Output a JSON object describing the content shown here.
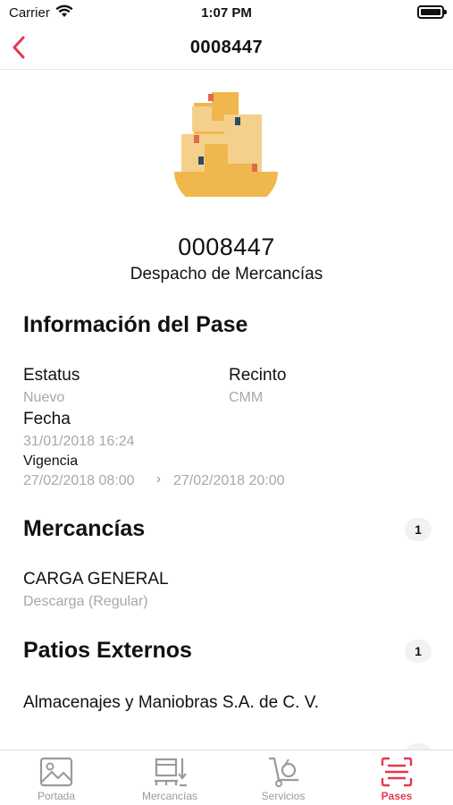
{
  "status_bar": {
    "carrier": "Carrier",
    "time": "1:07 PM"
  },
  "nav": {
    "title": "0008447"
  },
  "header": {
    "number": "0008447",
    "subtitle": "Despacho de Mercancías"
  },
  "info": {
    "title": "Información del Pase",
    "estatus_label": "Estatus",
    "estatus_value": "Nuevo",
    "recinto_label": "Recinto",
    "recinto_value": "CMM",
    "fecha_label": "Fecha",
    "fecha_value": "31/01/2018 16:24",
    "vigencia_label": "Vigencia",
    "vigencia_start": "27/02/2018 08:00",
    "vigencia_end": "27/02/2018 20:00"
  },
  "mercancias": {
    "title": "Mercancías",
    "count": "1",
    "items": [
      {
        "name": "CARGA GENERAL",
        "detail": "Descarga (Regular)"
      }
    ]
  },
  "patios": {
    "title": "Patios Externos",
    "count": "1",
    "items": [
      {
        "name": "Almacenajes y Maniobras S.A. de C. V."
      }
    ]
  },
  "tabs": [
    {
      "label": "Portada",
      "icon": "image-icon",
      "active": false
    },
    {
      "label": "Mercancías",
      "icon": "cargo-icon",
      "active": false
    },
    {
      "label": "Servicios",
      "icon": "hand-truck-icon",
      "active": false
    },
    {
      "label": "Pases",
      "icon": "scan-icon",
      "active": true
    }
  ],
  "colors": {
    "accent": "#e5384f",
    "muted": "#a8a8a8",
    "box": "#f0b74e",
    "box_light": "#f5d08c"
  }
}
